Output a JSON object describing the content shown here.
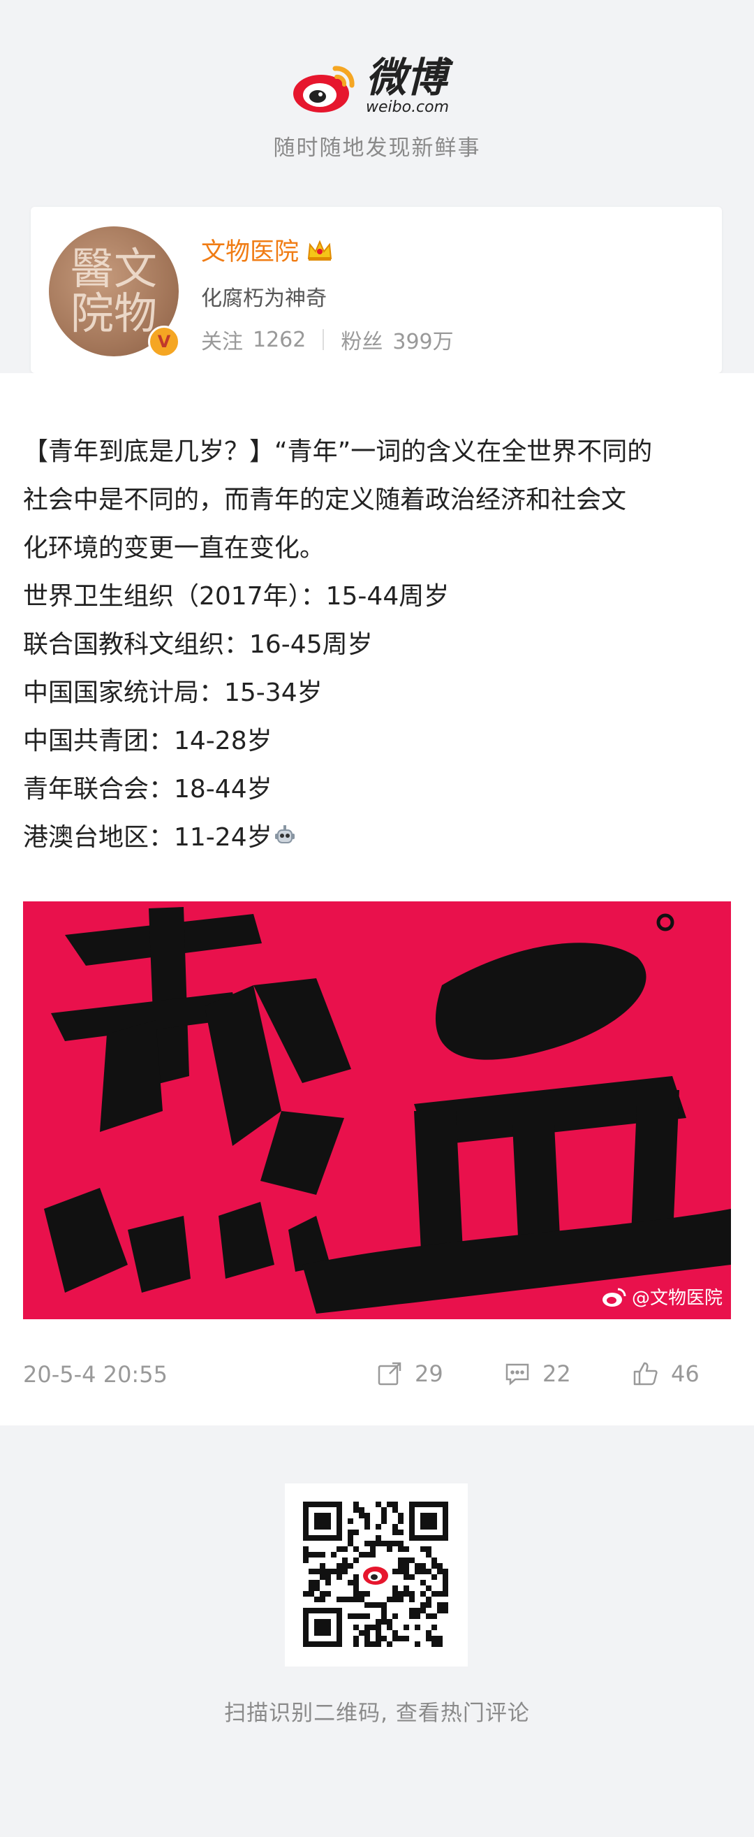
{
  "header": {
    "logo_cn": "微博",
    "logo_en": "weibo.com",
    "slogan": "随时随地发现新鲜事",
    "brand_red": "#e6162d",
    "brand_orange": "#f5a623"
  },
  "profile": {
    "avatar_text": "醫文院物",
    "name": "文物医院",
    "bio": "化腐朽为神奇",
    "following_label": "关注",
    "following_count": "1262",
    "followers_label": "粉丝",
    "followers_count": "399万",
    "verified_badge": "V",
    "name_color": "#f07c14",
    "icons": {
      "crown": "crown-icon",
      "verified": "verified-badge-icon"
    }
  },
  "post": {
    "lines": [
      "【青年到底是几岁？】“青年”一词的含义在全世界不同的",
      "社会中是不同的，而青年的定义随着政治经济和社会文",
      "化环境的变更一直在变化。",
      "世界卫生组织（2017年）：15-44周岁",
      "联合国教科文组织：16-45周岁",
      "中国国家统计局：15-34岁",
      "中国共青团：14-28岁",
      "青年联合会：18-44岁",
      "港澳台地区：11-24岁"
    ],
    "image": {
      "text": "熱血",
      "watermark": "@文物医院",
      "background": "#e9114c"
    },
    "timestamp": "20-5-4 20:55",
    "shares": "29",
    "comments": "22",
    "likes": "46"
  },
  "footer": {
    "qr_caption": "扫描识别二维码, 查看热门评论"
  }
}
